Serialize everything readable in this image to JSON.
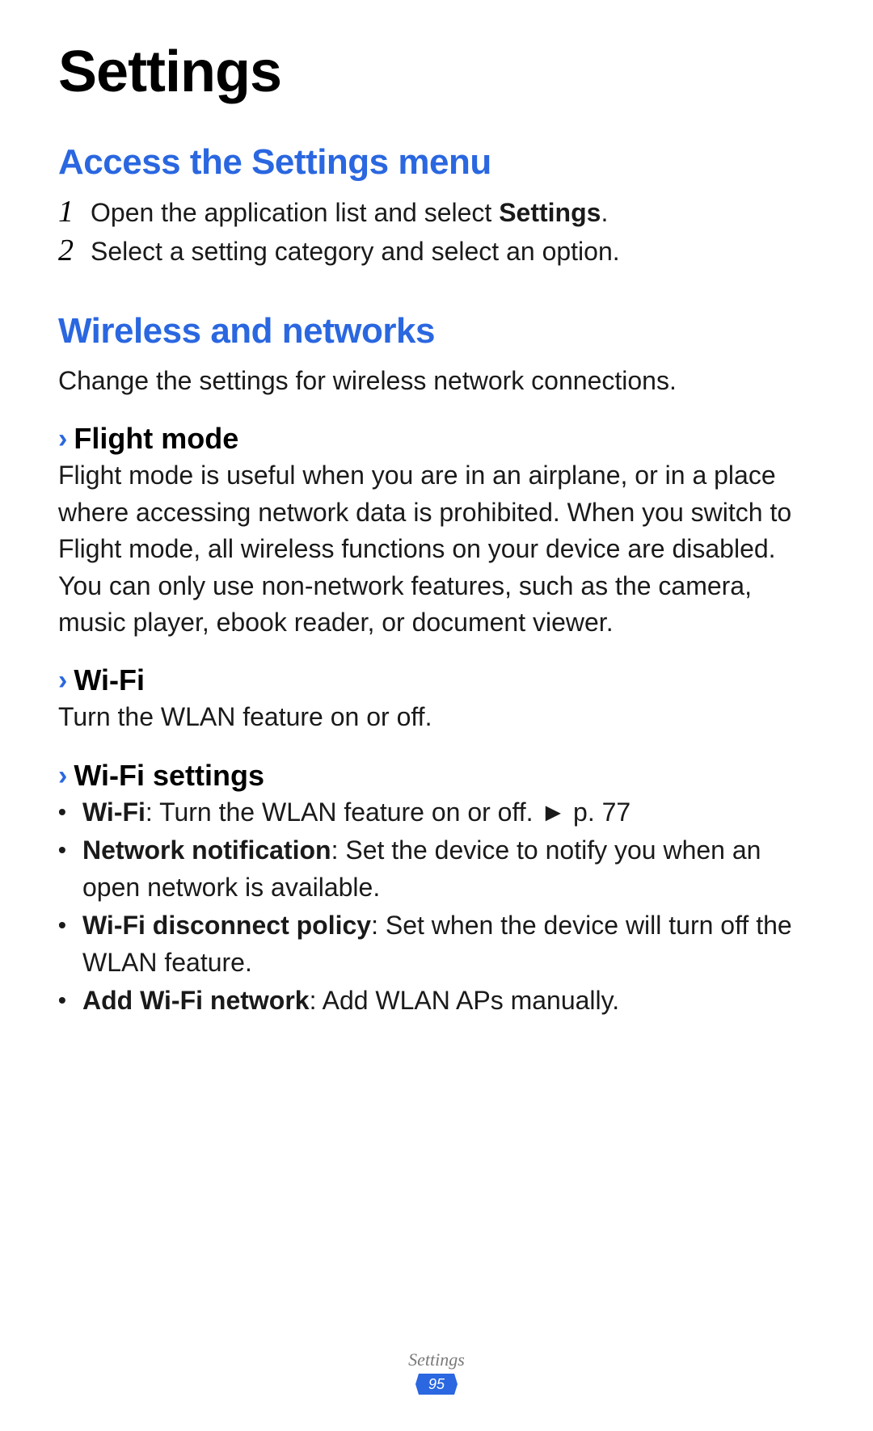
{
  "page_title": "Settings",
  "section1": {
    "heading": "Access the Settings menu",
    "steps": [
      {
        "num": "1",
        "text_prefix": "Open the application list and select ",
        "text_bold": "Settings",
        "text_suffix": "."
      },
      {
        "num": "2",
        "text_prefix": "Select a setting category and select an option.",
        "text_bold": "",
        "text_suffix": ""
      }
    ]
  },
  "section2": {
    "heading": "Wireless and networks",
    "intro": "Change the settings for wireless network connections.",
    "sub1": {
      "title": "Flight mode",
      "text": "Flight mode is useful when you are in an airplane, or in a place where accessing network data is prohibited. When you switch to Flight mode, all wireless functions on your device are disabled. You can only use non-network features, such as the camera, music player, ebook reader, or document viewer."
    },
    "sub2": {
      "title": "Wi-Fi",
      "text": "Turn the WLAN feature on or off."
    },
    "sub3": {
      "title": "Wi-Fi settings",
      "bullets": [
        {
          "bold": "Wi-Fi",
          "rest": ": Turn the WLAN feature on or off. ► p. 77"
        },
        {
          "bold": "Network notification",
          "rest": ": Set the device to notify you when an open network is available."
        },
        {
          "bold": "Wi-Fi disconnect policy",
          "rest": ": Set when the device will turn off the WLAN feature."
        },
        {
          "bold": "Add Wi-Fi network",
          "rest": ": Add WLAN APs manually."
        }
      ]
    }
  },
  "footer": {
    "section": "Settings",
    "page": "95"
  },
  "colors": {
    "accent": "#2a67e0"
  }
}
